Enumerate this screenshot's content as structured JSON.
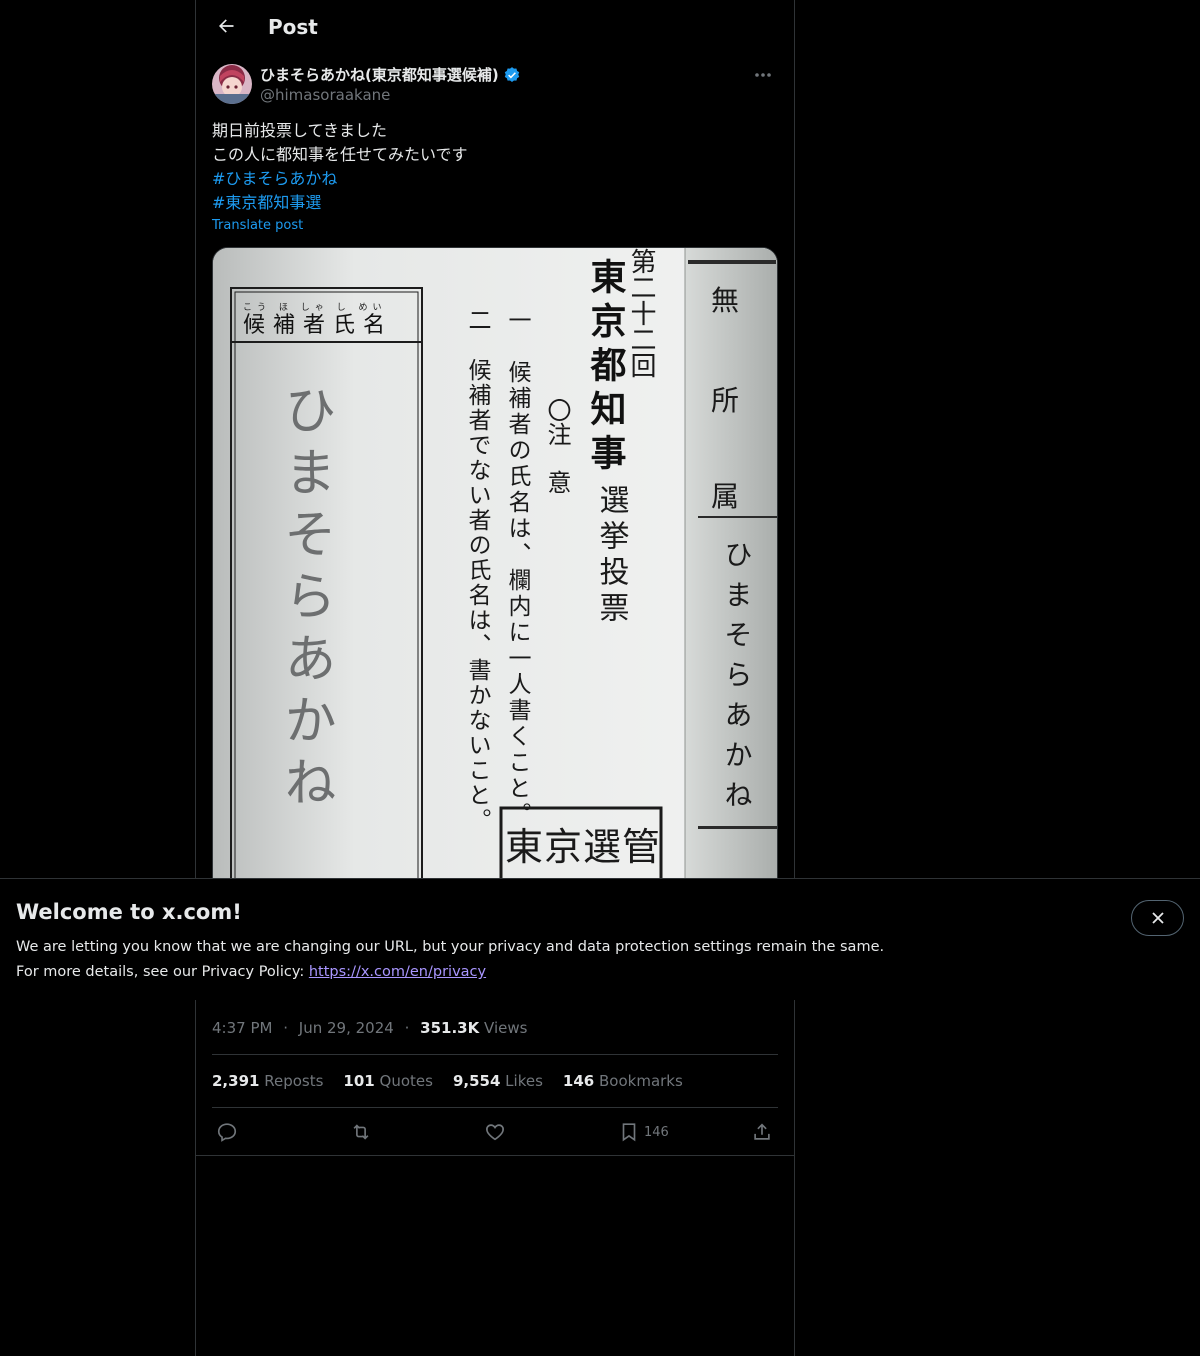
{
  "header": {
    "title": "Post"
  },
  "author": {
    "name": "ひまそらあかね(東京都知事選候補)",
    "handle": "@himasoraakane"
  },
  "tweet": {
    "lines": [
      "期日前投票してきました",
      "この人に都知事を任せてみたいです"
    ],
    "hashtags": [
      "#ひまそらあかね",
      "#東京都知事選"
    ],
    "translate_label": "Translate post"
  },
  "ballot": {
    "box_header": "候補者氏名",
    "box_header_ruby": "こう ほ しゃ し めい",
    "handwritten": "ひまそらあかね",
    "election_number": "第二十二回",
    "election_name_1": "東京都知事",
    "election_name_2": "選挙投票",
    "notice": "〇注　意",
    "rule_1": "一　候補者の氏名は、欄内に一人書くこと。",
    "rule_2": "二　候補者でない者の氏名は、書かないこと。",
    "stamp": "東京選管",
    "strip_1": "無",
    "strip_2": "所",
    "strip_3": "属",
    "strip_name": "ひまそらあかね"
  },
  "meta": {
    "time": "4:37 PM",
    "date": "Jun 29, 2024",
    "views_count": "351.3K",
    "views_label": "Views",
    "sep": "·"
  },
  "stats": {
    "reposts_count": "2,391",
    "reposts_label": "Reposts",
    "quotes_count": "101",
    "quotes_label": "Quotes",
    "likes_count": "9,554",
    "likes_label": "Likes",
    "bookmarks_count": "146",
    "bookmarks_label": "Bookmarks"
  },
  "actions": {
    "bookmark_count": "146"
  },
  "banner": {
    "title": "Welcome to x.com!",
    "line1": "We are letting you know that we are changing our URL, but your privacy and data protection settings remain the same.",
    "line2_prefix": "For more details, see our Privacy Policy: ",
    "link": "https://x.com/en/privacy"
  },
  "colors": {
    "accent": "#1d9bf0",
    "muted": "#71767b",
    "link_visited": "#a996ff",
    "border": "#2f3336"
  },
  "icons": [
    "back-arrow-icon",
    "verified-badge-icon",
    "more-icon",
    "reply-icon",
    "repost-icon",
    "like-icon",
    "bookmark-icon",
    "share-icon",
    "close-icon"
  ]
}
